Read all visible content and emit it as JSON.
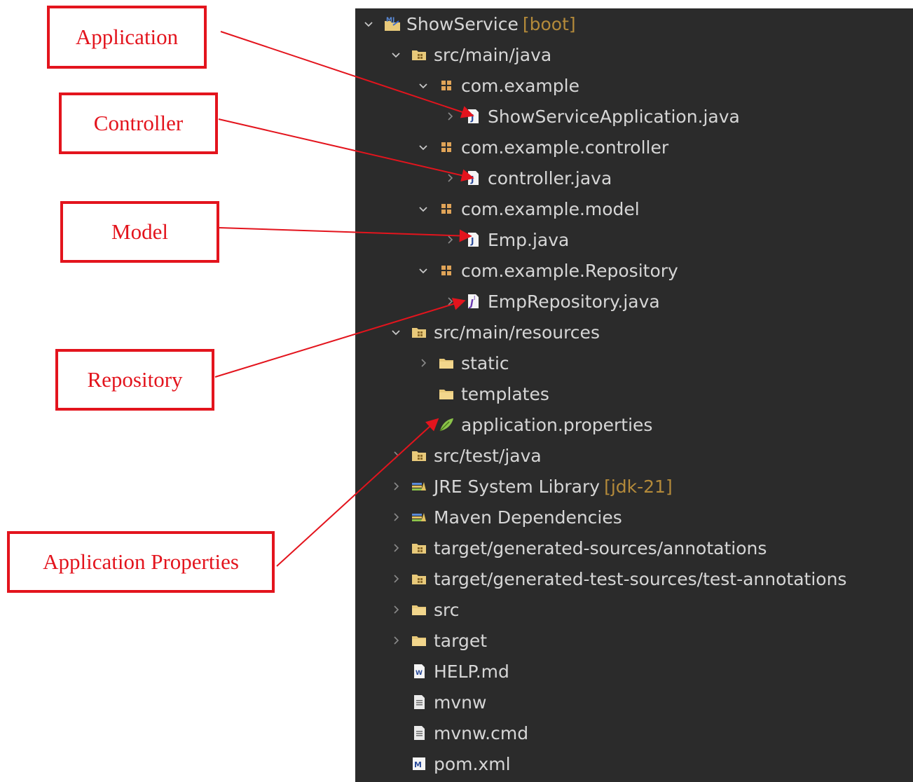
{
  "callouts": {
    "application": "Application",
    "controller": "Controller",
    "model": "Model",
    "repository": "Repository",
    "app_properties": "Application Properties"
  },
  "tree": {
    "project": {
      "name": "ShowService",
      "decoration": "[boot]",
      "icon": "maven-project-icon"
    },
    "src_main_java": {
      "label": "src/main/java",
      "icon": "source-folder-icon"
    },
    "pkg_example": {
      "label": "com.example",
      "icon": "package-icon"
    },
    "file_app": {
      "label": "ShowServiceApplication.java",
      "icon": "java-class-icon"
    },
    "pkg_controller": {
      "label": "com.example.controller",
      "icon": "package-icon"
    },
    "file_controller": {
      "label": "controller.java",
      "icon": "java-class-icon"
    },
    "pkg_model": {
      "label": "com.example.model",
      "icon": "package-icon"
    },
    "file_emp": {
      "label": "Emp.java",
      "icon": "java-class-icon"
    },
    "pkg_repository": {
      "label": "com.example.Repository",
      "icon": "package-icon"
    },
    "file_repo": {
      "label": "EmpRepository.java",
      "icon": "java-interface-icon"
    },
    "src_main_resources": {
      "label": "src/main/resources",
      "icon": "source-folder-icon"
    },
    "folder_static": {
      "label": "static",
      "icon": "folder-icon"
    },
    "folder_templates": {
      "label": "templates",
      "icon": "folder-icon"
    },
    "file_props": {
      "label": "application.properties",
      "icon": "spring-properties-icon"
    },
    "src_test_java": {
      "label": "src/test/java",
      "icon": "source-folder-icon"
    },
    "jre": {
      "label": "JRE System Library",
      "decoration": "[jdk-21]",
      "icon": "library-icon"
    },
    "maven_deps": {
      "label": "Maven Dependencies",
      "icon": "library-icon"
    },
    "gen_sources": {
      "label": "target/generated-sources/annotations",
      "icon": "source-folder-icon"
    },
    "gen_test_sources": {
      "label": "target/generated-test-sources/test-annotations",
      "icon": "source-folder-icon"
    },
    "folder_src": {
      "label": "src",
      "icon": "folder-icon"
    },
    "folder_target": {
      "label": "target",
      "icon": "folder-icon"
    },
    "file_help": {
      "label": "HELP.md",
      "icon": "markdown-file-icon"
    },
    "file_mvnw": {
      "label": "mvnw",
      "icon": "text-file-icon"
    },
    "file_mvnw_cmd": {
      "label": "mvnw.cmd",
      "icon": "text-file-icon"
    },
    "file_pom": {
      "label": "pom.xml",
      "icon": "maven-pom-icon"
    }
  },
  "colors": {
    "panel_background": "#2b2b2b",
    "tree_text": "#d6d6d6",
    "decoration_text": "#b48a3a",
    "callout_red": "#e3141d"
  }
}
